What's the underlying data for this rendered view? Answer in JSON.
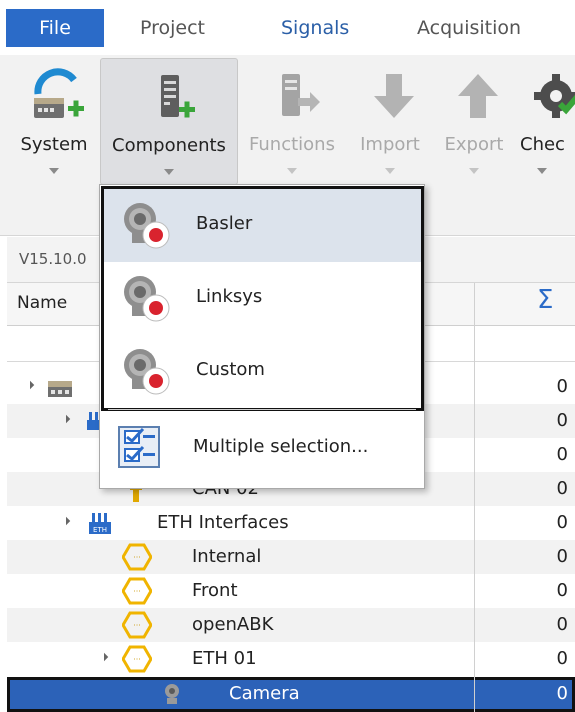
{
  "tabs": {
    "file": "File",
    "project": "Project",
    "signals": "Signals",
    "acquisition": "Acquisition"
  },
  "ribbon": {
    "system": "System",
    "components": "Components",
    "functions": "Functions",
    "import": "Import",
    "export": "Export",
    "check": "Chec"
  },
  "panel": {
    "version": "V15.10.0",
    "name_header": "Name",
    "sum_header": "Σ"
  },
  "tree": {
    "rows": [
      {
        "label": "",
        "value": "0"
      },
      {
        "label": "",
        "value": "0"
      },
      {
        "label": "",
        "value": "0"
      },
      {
        "label": "CAN 02",
        "value": "0"
      },
      {
        "label": "ETH Interfaces",
        "value": "0"
      },
      {
        "label": "Internal",
        "value": "0"
      },
      {
        "label": "Front",
        "value": "0"
      },
      {
        "label": "openABK",
        "value": "0"
      },
      {
        "label": "ETH 01",
        "value": "0"
      },
      {
        "label": "Camera",
        "value": "0"
      }
    ]
  },
  "menu": {
    "basler": "Basler",
    "linksys": "Linksys",
    "custom": "Custom",
    "multiple": "Multiple selection..."
  },
  "colors": {
    "accent": "#2b6bc8",
    "selection": "#2c62b8",
    "menu_highlight": "#dce3ec",
    "record": "#d9232e"
  }
}
